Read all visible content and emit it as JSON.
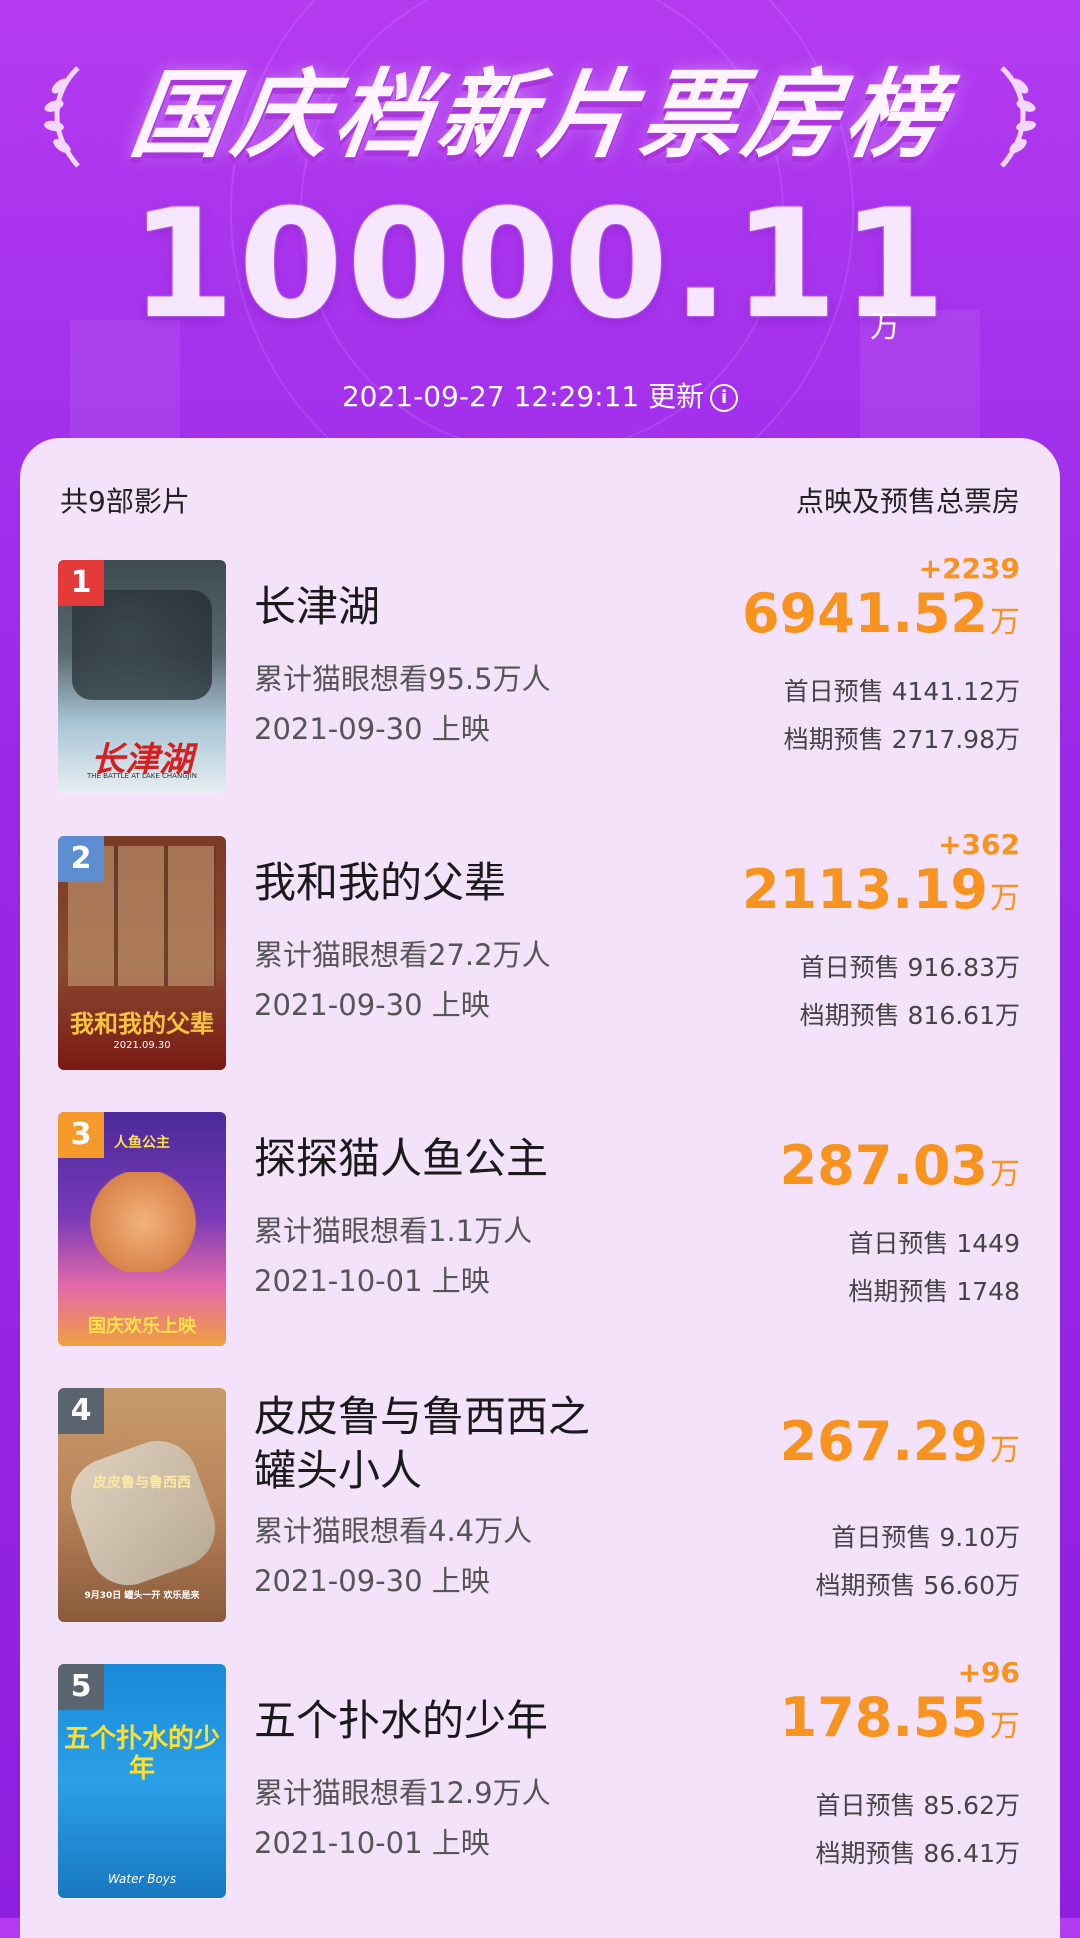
{
  "header": {
    "title": "国庆档新片票房榜",
    "total": "10000.11",
    "total_unit": "万",
    "update_text": "2021-09-27 12:29:11 更新",
    "info_icon": "info-icon"
  },
  "list_header": {
    "count_label": "共9部影片",
    "column_label": "点映及预售总票房"
  },
  "movies": [
    {
      "rank": "1",
      "title": "长津湖",
      "want": "累计猫眼想看95.5万人",
      "release": "2021-09-30 上映",
      "delta": "+2239",
      "box": "6941.52",
      "unit": "万",
      "first_day": "首日预售 4141.12万",
      "period": "档期预售 2717.98万",
      "poster_text": "长津湖",
      "poster_subtext": "THE BATTLE AT LAKE CHANGJIN"
    },
    {
      "rank": "2",
      "title": "我和我的父辈",
      "want": "累计猫眼想看27.2万人",
      "release": "2021-09-30 上映",
      "delta": "+362",
      "box": "2113.19",
      "unit": "万",
      "first_day": "首日预售 916.83万",
      "period": "档期预售 816.61万",
      "poster_text": "我和我的父辈",
      "poster_subtext": "2021.09.30"
    },
    {
      "rank": "3",
      "title": "探探猫人鱼公主",
      "want": "累计猫眼想看1.1万人",
      "release": "2021-10-01 上映",
      "delta": "",
      "box": "287.03",
      "unit": "万",
      "first_day": "首日预售 1449",
      "period": "档期预售 1748",
      "poster_text": "国庆欢乐上映",
      "poster_subtext": "人鱼公主"
    },
    {
      "rank": "4",
      "title_line1": "皮皮鲁与鲁西西之",
      "title_line2": "罐头小人",
      "want": "累计猫眼想看4.4万人",
      "release": "2021-09-30 上映",
      "delta": "",
      "box": "267.29",
      "unit": "万",
      "first_day": "首日预售 9.10万",
      "period": "档期预售 56.60万",
      "poster_text": "皮皮鲁与鲁西西",
      "poster_subtext": "9月30日 罐头一开 欢乐是来"
    },
    {
      "rank": "5",
      "title": "五个扑水的少年",
      "want": "累计猫眼想看12.9万人",
      "release": "2021-10-01 上映",
      "delta": "+96",
      "box": "178.55",
      "unit": "万",
      "first_day": "首日预售 85.62万",
      "period": "档期预售 86.41万",
      "poster_text": "五个扑水的少年",
      "poster_subtext": "Water Boys"
    }
  ],
  "colors": {
    "accent": "#f7931e",
    "rank1": "#e53a3a",
    "rank2": "#5c8ed1",
    "rank3": "#f59a2b",
    "rank_other": "#5b6570",
    "bg_top": "#b43bf0",
    "card_bg": "#f3e2fa"
  }
}
